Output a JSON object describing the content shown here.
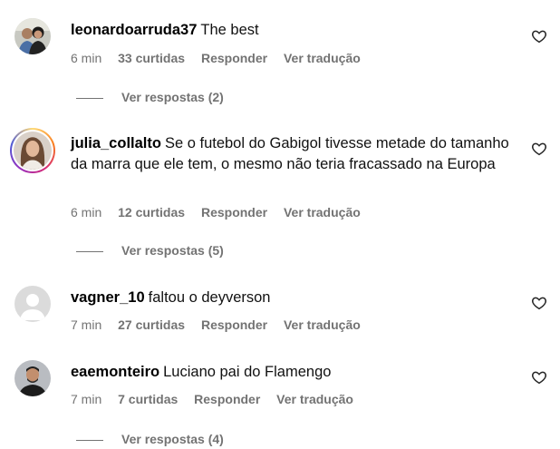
{
  "comments": [
    {
      "username": "leonardoarruda37",
      "text": "The best",
      "time": "6 min",
      "likes": "33 curtidas",
      "reply": "Responder",
      "translate": "Ver tradução",
      "view_replies": "Ver respostas (2)",
      "avatar_icon": "couple-photo-avatar"
    },
    {
      "username": "julia_collalto",
      "text": "Se o futebol do Gabigol tivesse metade do tamanho da marra que ele tem, o mesmo não teria fracassado na Europa",
      "time": "6 min",
      "likes": "12 curtidas",
      "reply": "Responder",
      "translate": "Ver tradução",
      "view_replies": "Ver respostas (5)",
      "avatar_icon": "woman-photo-avatar-with-story-ring"
    },
    {
      "username": "vagner_10",
      "text": "faltou o deyverson",
      "time": "7 min",
      "likes": "27 curtidas",
      "reply": "Responder",
      "translate": "Ver tradução",
      "avatar_icon": "default-avatar"
    },
    {
      "username": "eaemonteiro",
      "text": "Luciano pai do Flamengo",
      "time": "7 min",
      "likes": "7 curtidas",
      "reply": "Responder",
      "translate": "Ver tradução",
      "view_replies": "Ver respostas (4)",
      "avatar_icon": "man-photo-avatar"
    }
  ],
  "colors": {
    "secondary_text": "#737373",
    "primary_text": "#000000"
  }
}
